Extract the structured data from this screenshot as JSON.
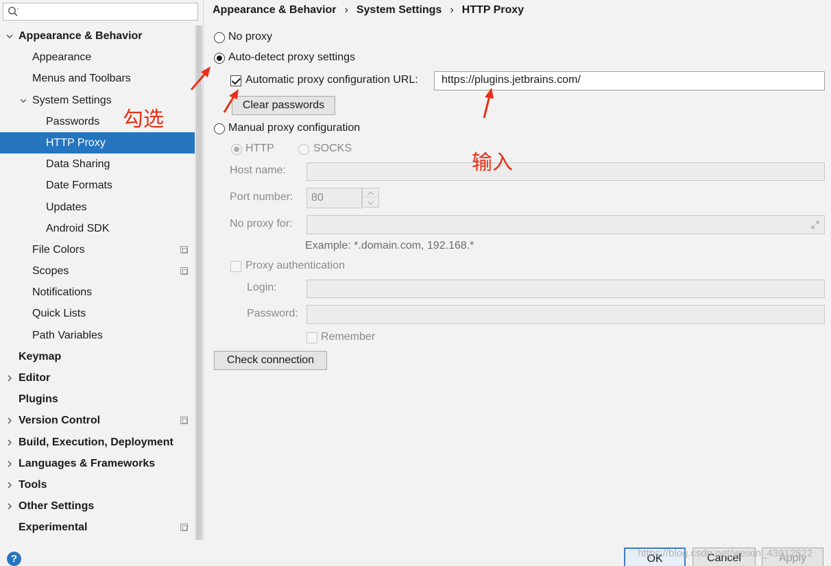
{
  "sidebar": {
    "search": {
      "placeholder": "",
      "value": ""
    },
    "items": [
      {
        "label": "Appearance & Behavior",
        "bold": true,
        "chevron": "down"
      },
      {
        "label": "Appearance"
      },
      {
        "label": "Menus and Toolbars"
      },
      {
        "label": "System Settings",
        "chevron": "down"
      },
      {
        "label": "Passwords"
      },
      {
        "label": "HTTP Proxy",
        "selected": true
      },
      {
        "label": "Data Sharing"
      },
      {
        "label": "Date Formats"
      },
      {
        "label": "Updates"
      },
      {
        "label": "Android SDK"
      },
      {
        "label": "File Colors",
        "icon": "copy-icon"
      },
      {
        "label": "Scopes",
        "icon": "copy-icon"
      },
      {
        "label": "Notifications"
      },
      {
        "label": "Quick Lists"
      },
      {
        "label": "Path Variables"
      },
      {
        "label": "Keymap",
        "bold": true
      },
      {
        "label": "Editor",
        "bold": true,
        "chevron": "right"
      },
      {
        "label": "Plugins",
        "bold": true
      },
      {
        "label": "Version Control",
        "bold": true,
        "chevron": "right",
        "icon": "copy-icon"
      },
      {
        "label": "Build, Execution, Deployment",
        "bold": true,
        "chevron": "right"
      },
      {
        "label": "Languages & Frameworks",
        "bold": true,
        "chevron": "right"
      },
      {
        "label": "Tools",
        "bold": true,
        "chevron": "right"
      },
      {
        "label": "Other Settings",
        "bold": true,
        "chevron": "right"
      },
      {
        "label": "Experimental",
        "bold": true,
        "icon": "copy-icon"
      }
    ]
  },
  "breadcrumb": [
    "Appearance & Behavior",
    "System Settings",
    "HTTP Proxy"
  ],
  "proxy": {
    "no_proxy": "No proxy",
    "auto_detect": "Auto-detect proxy settings",
    "auto_config_url_label": "Automatic proxy configuration URL:",
    "auto_config_url_value": "https://plugins.jetbrains.com/",
    "clear_passwords": "Clear passwords",
    "manual": "Manual proxy configuration",
    "http": "HTTP",
    "socks": "SOCKS",
    "host_name_label": "Host name:",
    "port_number_label": "Port number:",
    "port_number_value": "80",
    "no_proxy_for_label": "No proxy for:",
    "example": "Example: *.domain.com, 192.168.*",
    "proxy_auth": "Proxy authentication",
    "login_label": "Login:",
    "password_label": "Password:",
    "remember": "Remember",
    "check_connection": "Check connection"
  },
  "annotations": {
    "check_note": "勾选",
    "input_note": "输入"
  },
  "footer": {
    "help": "?",
    "ok": "OK",
    "cancel": "Cancel",
    "apply": "Apply",
    "watermark": "https://blog.csdn.net/weixin_43912822"
  },
  "colors": {
    "selection": "#2675bf",
    "annotation": "#e83018"
  }
}
